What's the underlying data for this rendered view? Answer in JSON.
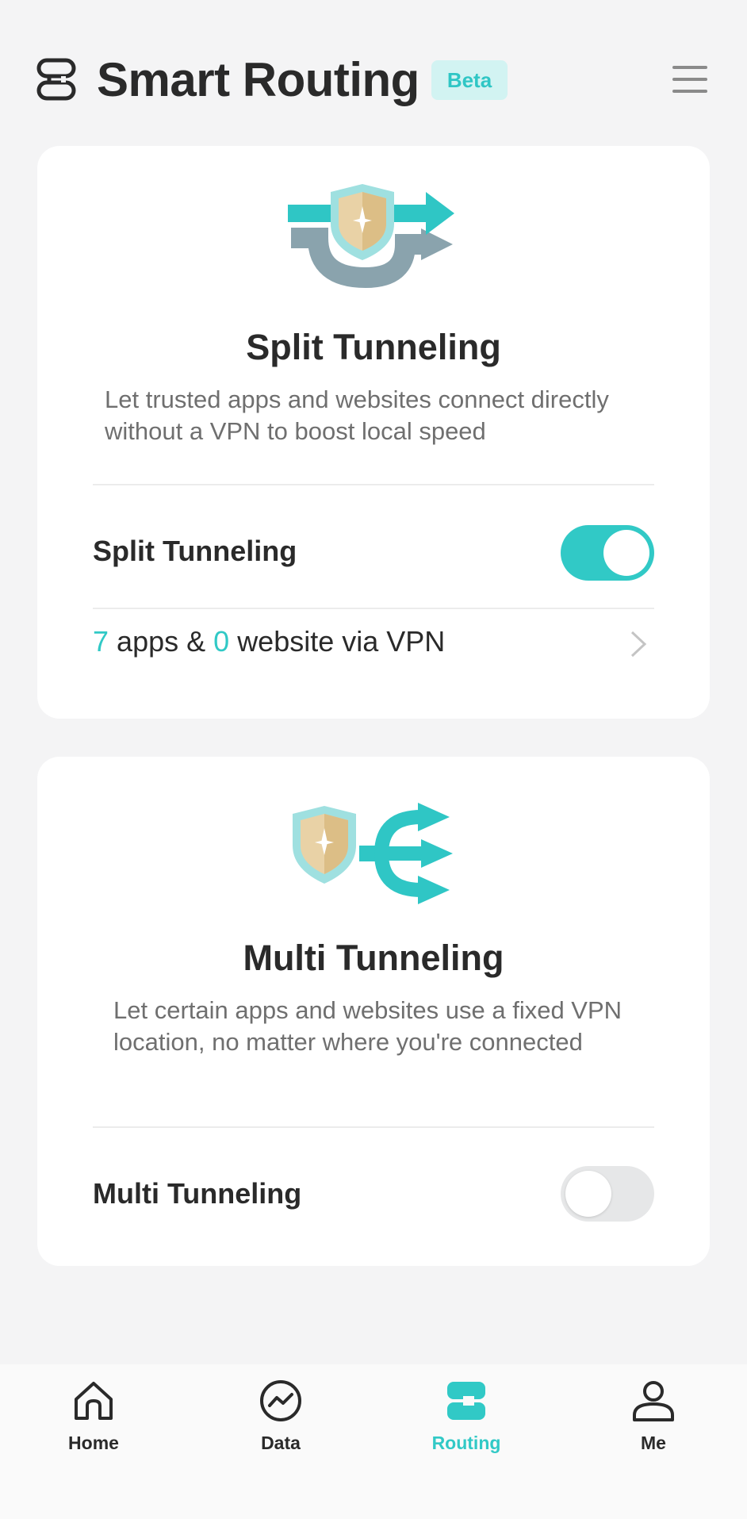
{
  "header": {
    "title": "Smart Routing",
    "badge": "Beta",
    "icons": {
      "app": "routing-icon",
      "menu": "hamburger-menu-icon"
    }
  },
  "split": {
    "title": "Split Tunneling",
    "description": "Let trusted apps and websites connect directly without a VPN to boost local speed",
    "toggle_label": "Split Tunneling",
    "toggle_on": true,
    "apps_count": "7",
    "apps_text": "apps &",
    "websites_count": "0",
    "websites_text": "website via VPN"
  },
  "multi": {
    "title": "Multi Tunneling",
    "description": "Let certain apps and websites use a fixed VPN location, no matter where you're connected",
    "toggle_label": "Multi Tunneling",
    "toggle_on": false
  },
  "nav": {
    "items": [
      {
        "label": "Home",
        "icon": "home-icon",
        "active": false
      },
      {
        "label": "Data",
        "icon": "data-chart-icon",
        "active": false
      },
      {
        "label": "Routing",
        "icon": "routing-icon",
        "active": true
      },
      {
        "label": "Me",
        "icon": "user-icon",
        "active": false
      }
    ]
  },
  "colors": {
    "accent": "#31c9c6",
    "background": "#f4f4f5",
    "card": "#ffffff",
    "badge_bg": "#d2f3f2",
    "text": "#2a2a2a",
    "muted": "#6f6f6f"
  }
}
